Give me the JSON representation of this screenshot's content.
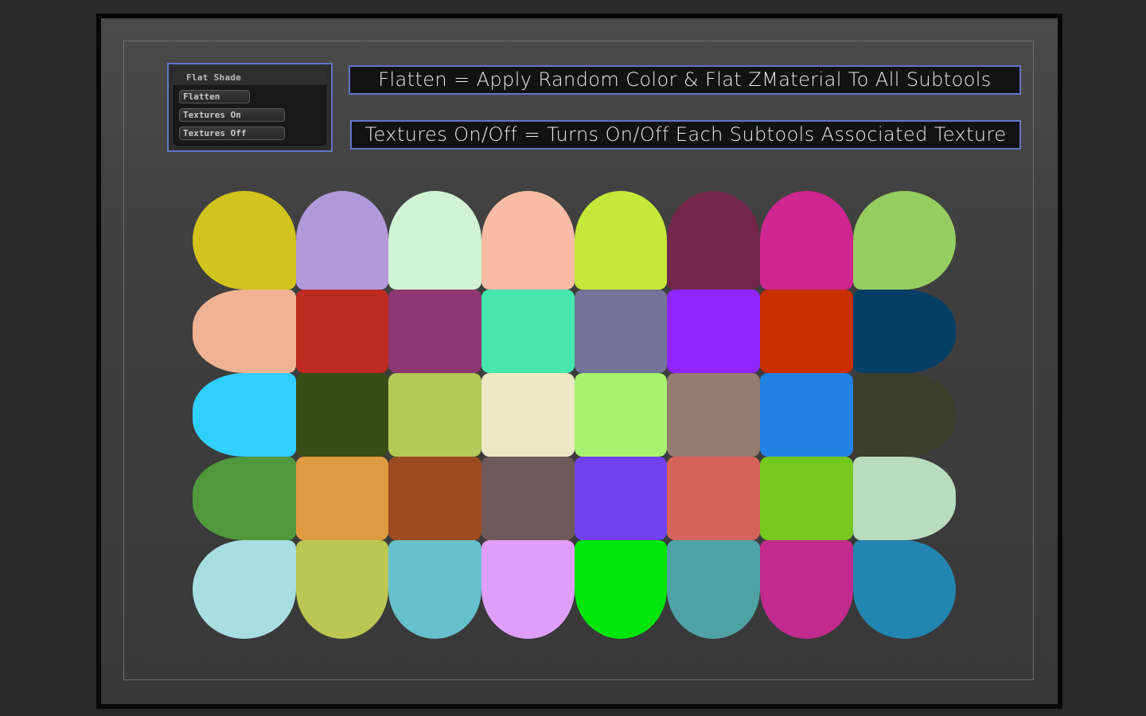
{
  "panel": {
    "title": "Flat Shade",
    "buttons": [
      {
        "label": "Flatten"
      },
      {
        "label": "Textures On"
      },
      {
        "label": "Textures Off"
      }
    ]
  },
  "info": {
    "flatten": "Flatten = Apply Random Color & Flat ZMaterial To All Subtools",
    "textures": "Textures On/Off = Turns On/Off Each Subtools Associated Texture"
  },
  "colors": {
    "accent_border": "#5d78c6",
    "background": "#2a2a2a",
    "workspace": "#404040"
  },
  "swatches": [
    [
      "#d2c41c",
      "#b19adc",
      "#d1f3d3",
      "#f8bba6",
      "#c4e938",
      "#74274a",
      "#d02691",
      "#96cd60"
    ],
    [
      "#efb393",
      "#be2a1f",
      "#8e3771",
      "#46e6ac",
      "#727497",
      "#8f25fe",
      "#c92e00",
      "#063f66"
    ],
    [
      "#30d0fe",
      "#384d15",
      "#b2cc57",
      "#ede8c5",
      "#a7f36f",
      "#957c70",
      "#2282e3",
      "#3b3e2b"
    ],
    [
      "#4f993c",
      "#df9b41",
      "#9c4a1f",
      "#705a59",
      "#7041ed",
      "#d6645b",
      "#75c81e",
      "#b8dcbd"
    ],
    [
      "#a7dee1",
      "#bbc752",
      "#67c1cc",
      "#df9efa",
      "#00e50a",
      "#4fa2a6",
      "#c22b8d",
      "#2385b1"
    ]
  ]
}
